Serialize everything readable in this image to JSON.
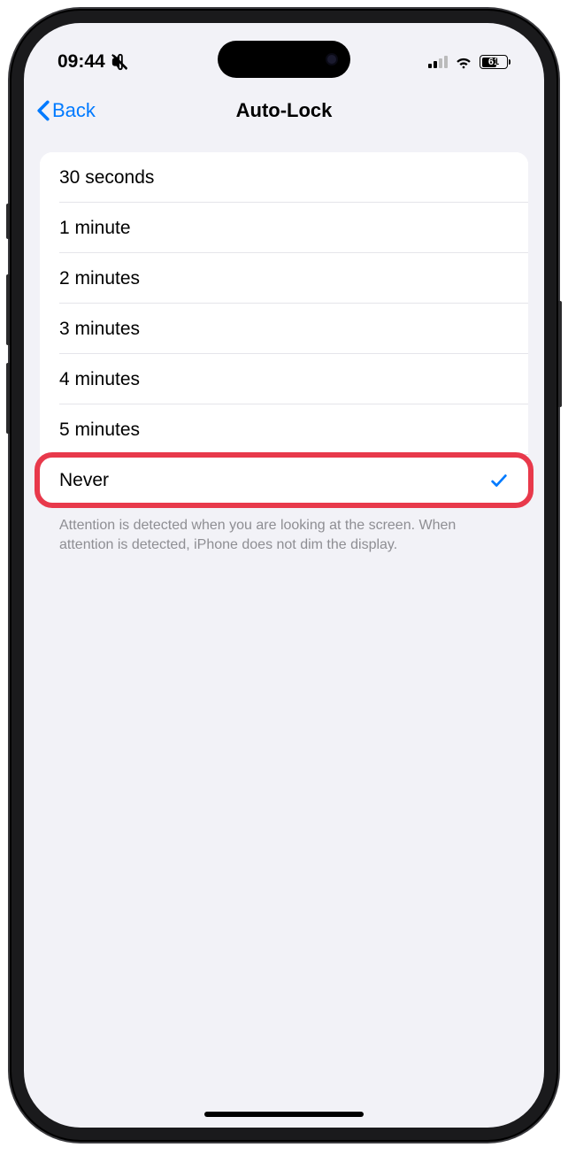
{
  "status": {
    "time": "09:44",
    "battery_percent": "61"
  },
  "nav": {
    "back_label": "Back",
    "title": "Auto-Lock"
  },
  "options": [
    {
      "label": "30 seconds",
      "selected": false
    },
    {
      "label": "1 minute",
      "selected": false
    },
    {
      "label": "2 minutes",
      "selected": false
    },
    {
      "label": "3 minutes",
      "selected": false
    },
    {
      "label": "4 minutes",
      "selected": false
    },
    {
      "label": "5 minutes",
      "selected": false
    },
    {
      "label": "Never",
      "selected": true,
      "highlighted": true
    }
  ],
  "footer": "Attention is detected when you are looking at the screen. When attention is detected, iPhone does not dim the display."
}
